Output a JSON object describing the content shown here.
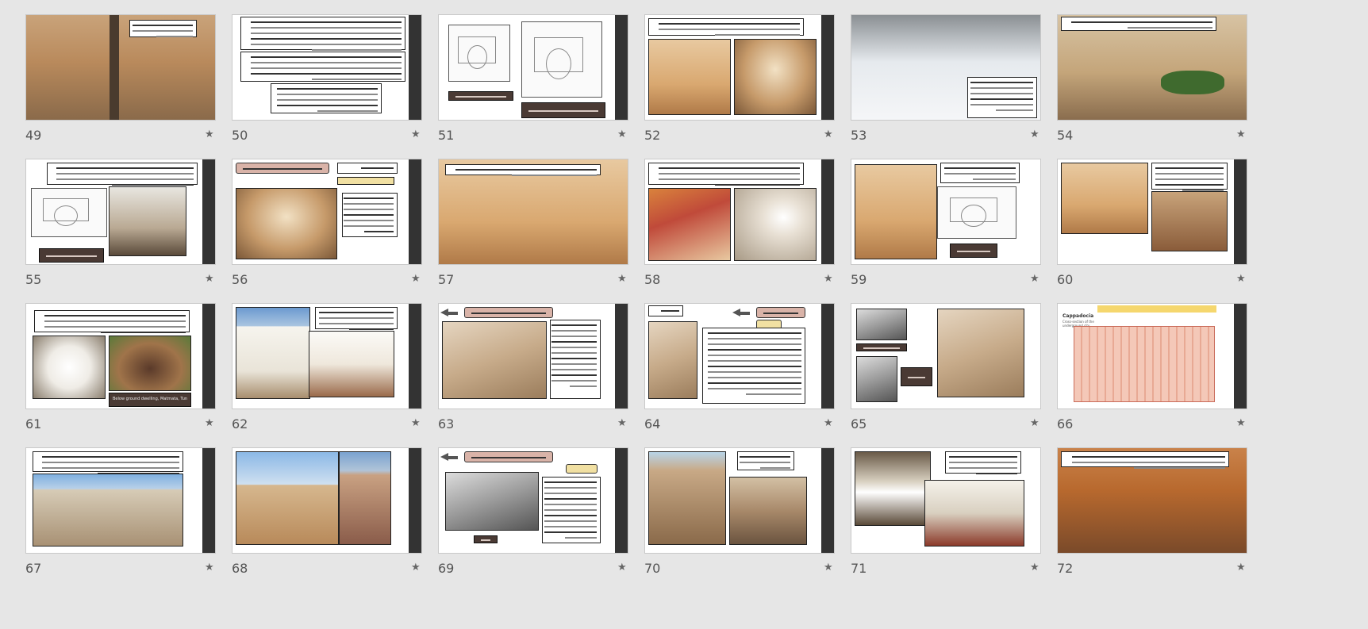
{
  "view": "slide-sorter",
  "colors": {
    "background": "#e6e6e6",
    "number_text": "#555555",
    "caption_bg": "#4a3a34",
    "title_pill": "#d9b3a8",
    "side_bar": "#333333"
  },
  "slides": [
    {
      "number": "49",
      "icon": "star-icon"
    },
    {
      "number": "50",
      "icon": "star-icon"
    },
    {
      "number": "51",
      "icon": "star-icon"
    },
    {
      "number": "52",
      "icon": "star-icon"
    },
    {
      "number": "53",
      "icon": "star-icon"
    },
    {
      "number": "54",
      "icon": "star-icon"
    },
    {
      "number": "55",
      "icon": "star-icon"
    },
    {
      "number": "56",
      "icon": "star-icon"
    },
    {
      "number": "57",
      "icon": "star-icon"
    },
    {
      "number": "58",
      "icon": "star-icon"
    },
    {
      "number": "59",
      "icon": "star-icon"
    },
    {
      "number": "60",
      "icon": "star-icon"
    },
    {
      "number": "61",
      "icon": "star-icon"
    },
    {
      "number": "62",
      "icon": "star-icon"
    },
    {
      "number": "63",
      "icon": "star-icon"
    },
    {
      "number": "64",
      "icon": "star-icon"
    },
    {
      "number": "65",
      "icon": "star-icon"
    },
    {
      "number": "66",
      "icon": "star-icon"
    },
    {
      "number": "67",
      "icon": "star-icon"
    },
    {
      "number": "68",
      "icon": "star-icon"
    },
    {
      "number": "69",
      "icon": "star-icon"
    },
    {
      "number": "70",
      "icon": "star-icon"
    },
    {
      "number": "71",
      "icon": "star-icon"
    },
    {
      "number": "72",
      "icon": "star-icon"
    }
  ],
  "slide_text": {
    "s61_caption": "Below ground dwelling, Matmata, Tunisia",
    "s66_label": "Cappadocia",
    "s66_sublabel": "Cross-section of the underground city"
  },
  "star_glyph": "★"
}
